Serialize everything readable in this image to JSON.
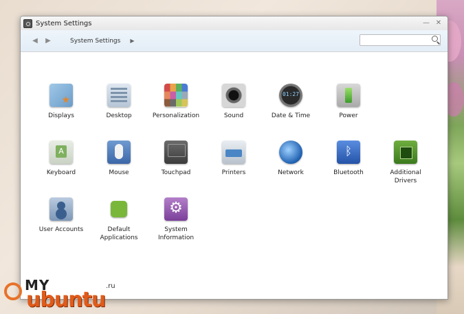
{
  "window": {
    "title": "System Settings",
    "minimize_glyph": "—",
    "close_glyph": "✕"
  },
  "toolbar": {
    "back_glyph": "◀",
    "forward_glyph": "▶",
    "breadcrumb": "System Settings",
    "breadcrumb_arrow": "▶",
    "search_placeholder": "",
    "search_value": ""
  },
  "items": [
    {
      "label": "Displays",
      "icon": "displays-icon"
    },
    {
      "label": "Desktop",
      "icon": "desktop-icon"
    },
    {
      "label": "Personalization",
      "icon": "personalization-icon"
    },
    {
      "label": "Sound",
      "icon": "sound-icon"
    },
    {
      "label": "Date & Time",
      "icon": "date-time-icon"
    },
    {
      "label": "Power",
      "icon": "power-icon"
    },
    {
      "label": "Keyboard",
      "icon": "keyboard-icon"
    },
    {
      "label": "Mouse",
      "icon": "mouse-icon"
    },
    {
      "label": "Touchpad",
      "icon": "touchpad-icon"
    },
    {
      "label": "Printers",
      "icon": "printers-icon"
    },
    {
      "label": "Network",
      "icon": "network-icon"
    },
    {
      "label": "Bluetooth",
      "icon": "bluetooth-icon"
    },
    {
      "label": "Additional\nDrivers",
      "icon": "additional-drivers-icon"
    },
    {
      "label": "User Accounts",
      "icon": "user-accounts-icon"
    },
    {
      "label": "Default\nApplications",
      "icon": "default-applications-icon"
    },
    {
      "label": "System\nInformation",
      "icon": "system-information-icon"
    }
  ],
  "watermark": {
    "my": "MY",
    "ubuntu": "ubuntu",
    "tld": ".ru"
  }
}
